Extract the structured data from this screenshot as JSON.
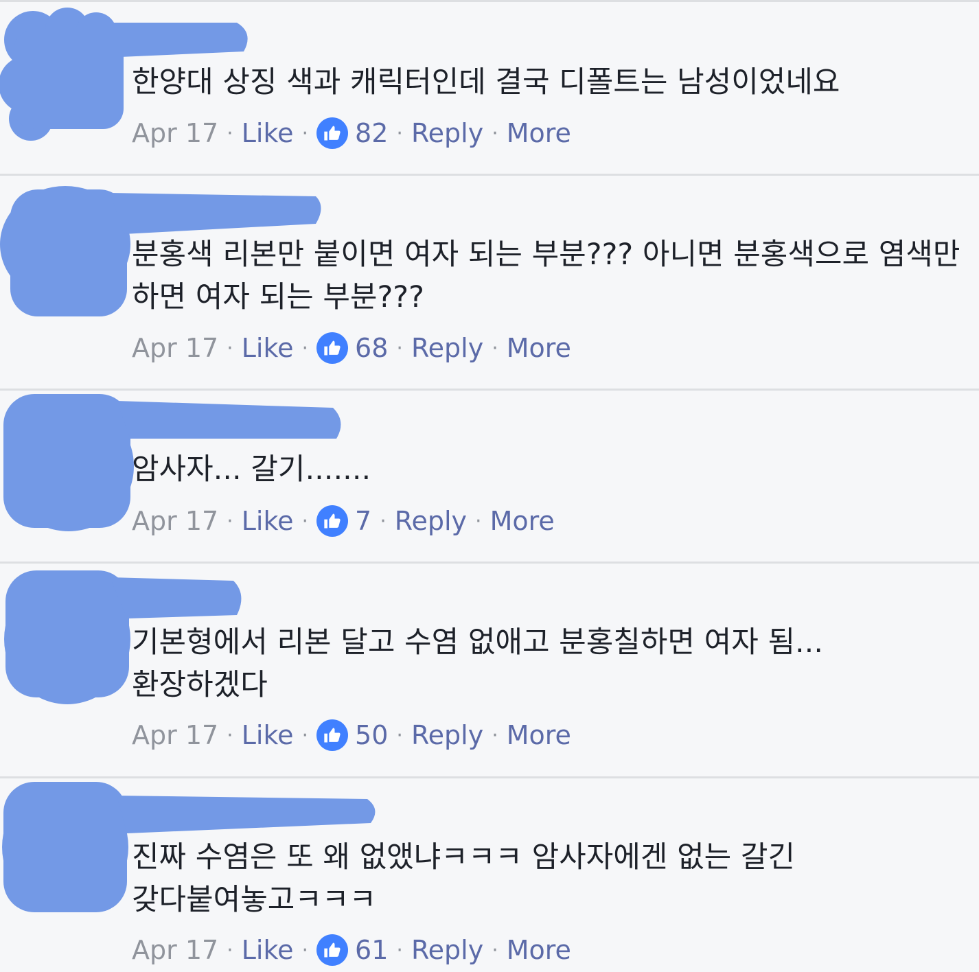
{
  "colors": {
    "background": "#f6f7f9",
    "divider": "#dddfe2",
    "text": "#1d2129",
    "meta_text": "#90949c",
    "link": "#5b6aa8",
    "like_badge": "#4080ff",
    "redaction": "#7399e6"
  },
  "meta_labels": {
    "like": "Like",
    "reply": "Reply",
    "more": "More",
    "separator": "·"
  },
  "comments": [
    {
      "text": "한양대 상징 색과 캐릭터인데 결국 디폴트는 남성이었네요",
      "date": "Apr 17",
      "likes": "82"
    },
    {
      "text": "분홍색 리본만 붙이면 여자 되는 부분??? 아니면 분홍색으로 염색만 하면 여자 되는 부분???",
      "date": "Apr 17",
      "likes": "68"
    },
    {
      "text": "암사자... 갈기.......",
      "date": "Apr 17",
      "likes": "7"
    },
    {
      "text": "기본형에서 리본 달고 수염 없애고 분홍칠하면 여자 됨... 환장하겠다",
      "date": "Apr 17",
      "likes": "50"
    },
    {
      "text": "진짜 수염은 또 왜 없앴냐ㅋㅋㅋ 암사자에겐 없는 갈긴 갖다붙여놓고ㅋㅋㅋ",
      "date": "Apr 17",
      "likes": "61"
    }
  ]
}
